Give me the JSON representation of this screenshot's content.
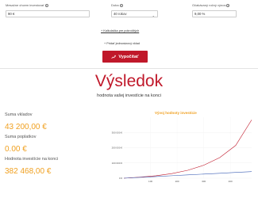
{
  "form": {
    "monthly_deposit": {
      "label": "Mesačne chcem investovať",
      "value": "90 €"
    },
    "period": {
      "label": "Doba",
      "value": "40 rokov"
    },
    "expected_return": {
      "label": "Očakávaný ročný výnos",
      "value": "9,00 %"
    },
    "advanced_calc_link": "+ Kalkulačka pre pokročilých",
    "one_time_deposit_link": "+ Pridať jednorázový vklad",
    "calculate_button": "Vypočítať"
  },
  "results": {
    "title": "Výsledok",
    "subtitle": "hodnota vašej investície na konci",
    "deposits_label": "Suma vkladov",
    "deposits_value": "43 200,00 €",
    "fees_label": "Suma poplatkov",
    "fees_value": "0.00 €",
    "end_value_label": "Hodnota investície na konci",
    "end_value_value": "382 468,00 €"
  },
  "chart_data": {
    "type": "line",
    "title": "Vývoj hodnoty investície",
    "y_tick_labels": [
      "0 €",
      "100 000 €",
      "200 000 €",
      "300 000 €"
    ],
    "x_tick_labels": [
      "100",
      "200",
      "300",
      "400"
    ],
    "series": [
      {
        "color": "#c0182a",
        "x": [
          0,
          60,
          120,
          180,
          240,
          300,
          360,
          420,
          480
        ],
        "y": [
          0,
          7000,
          16000,
          30000,
          52000,
          85000,
          135000,
          215000,
          382468
        ]
      },
      {
        "color": "#3c5fb5",
        "x": [
          0,
          60,
          120,
          180,
          240,
          300,
          360,
          420,
          480
        ],
        "y": [
          0,
          5400,
          10800,
          16200,
          21600,
          27000,
          32400,
          37800,
          43200
        ]
      }
    ],
    "xlim": [
      0,
      480
    ],
    "ylim": [
      0,
      400000
    ]
  },
  "colors": {
    "accent": "#c0182a",
    "highlight": "#f0a020"
  }
}
